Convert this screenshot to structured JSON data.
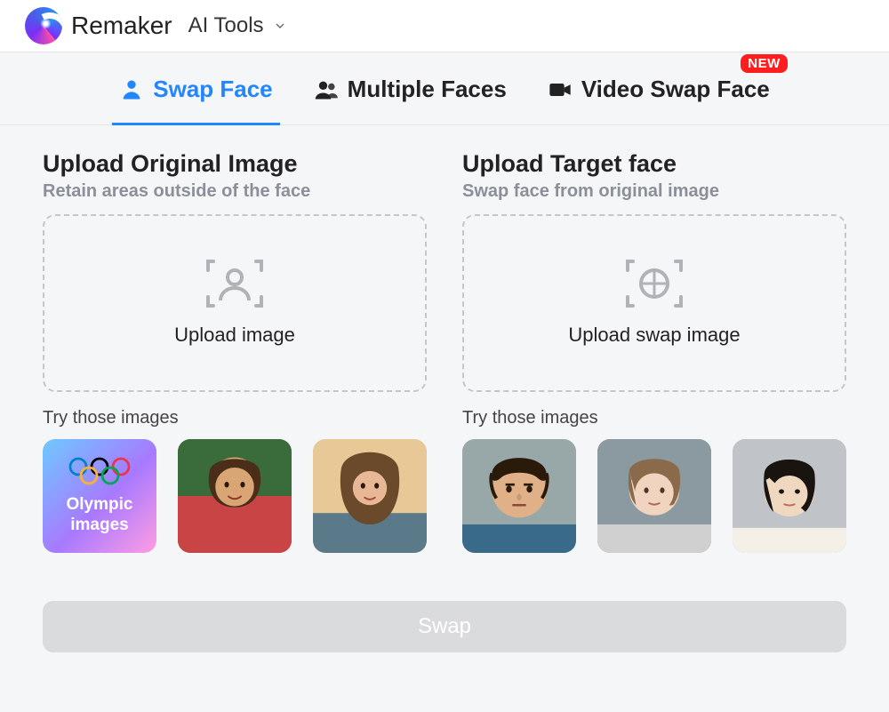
{
  "brand": "Remaker",
  "nav": {
    "ai_tools": "AI Tools"
  },
  "tabs": {
    "swap_face": "Swap Face",
    "multiple_faces": "Multiple Faces",
    "video_swap_face": "Video Swap Face",
    "new_badge": "NEW"
  },
  "left": {
    "title": "Upload Original Image",
    "subtitle": "Retain areas outside of the face",
    "dropzone_text": "Upload image",
    "try_label": "Try those images",
    "olympic_label": "Olympic images"
  },
  "right": {
    "title": "Upload Target face",
    "subtitle": "Swap face from original image",
    "dropzone_text": "Upload swap image",
    "try_label": "Try those images"
  },
  "swap_button": "Swap",
  "colors": {
    "accent": "#2286ff",
    "badge": "#ff1e1e"
  }
}
